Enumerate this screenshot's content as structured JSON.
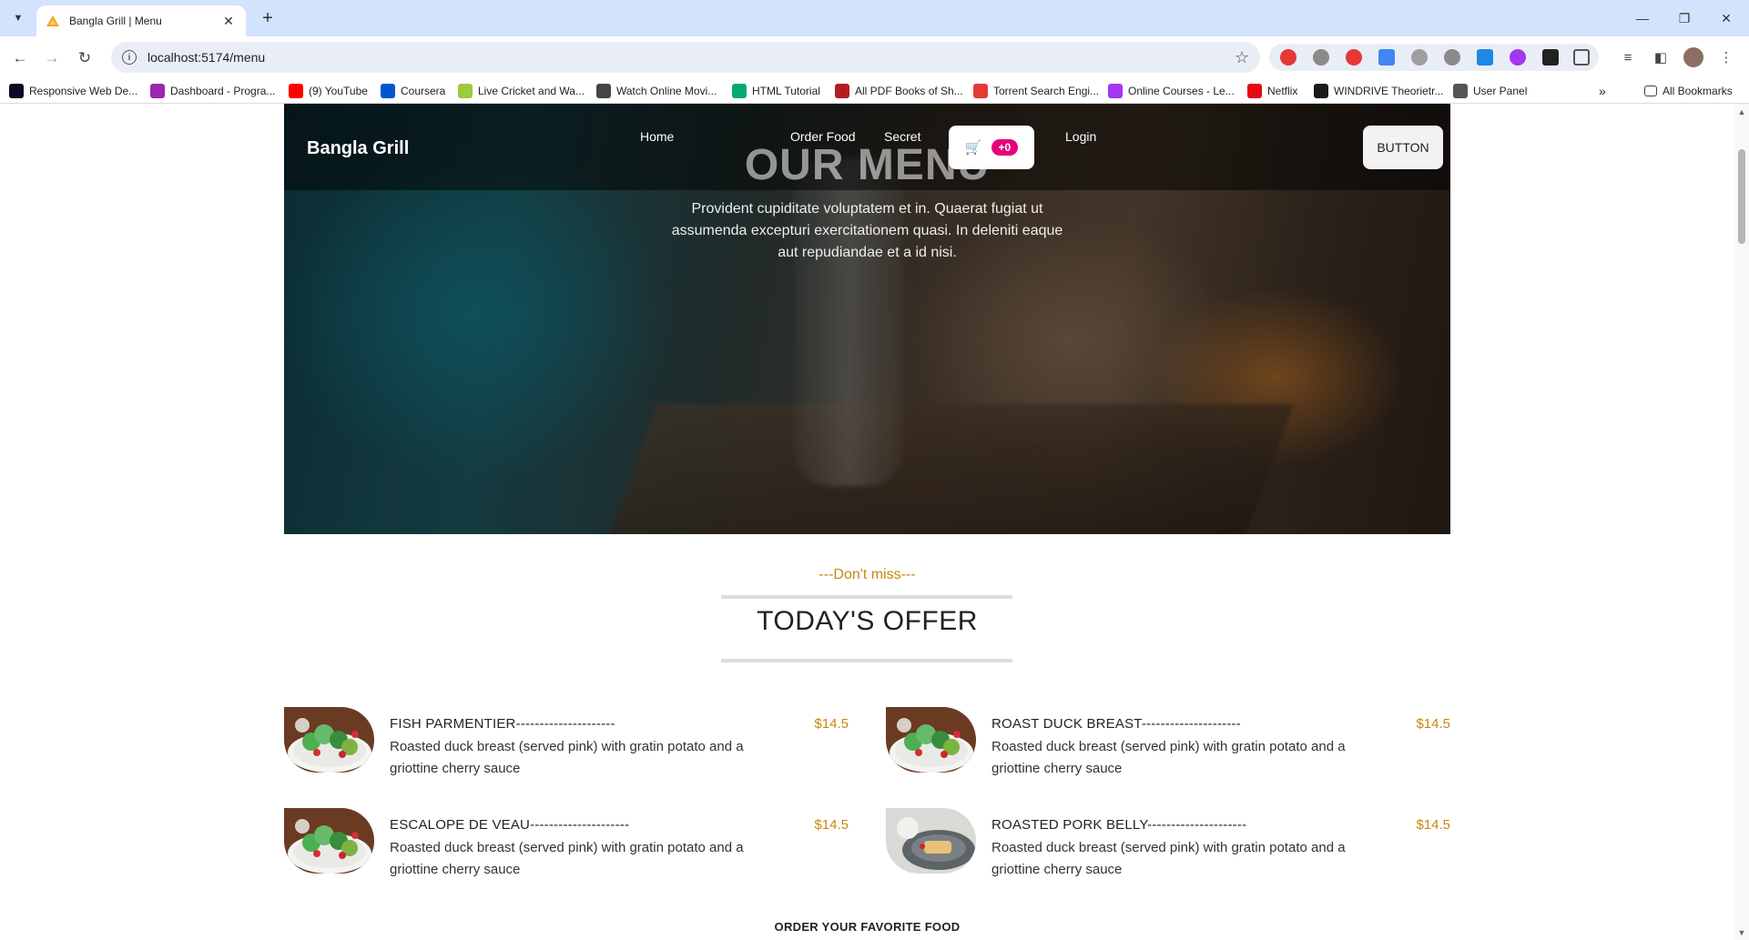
{
  "browser": {
    "tab_title": "Bangla Grill | Menu",
    "url": "localhost:5174/menu",
    "bookmarks": [
      {
        "label": "Responsive Web De...",
        "icon": "fcc-icon",
        "color": "#0a0a23"
      },
      {
        "label": "Dashboard - Progra...",
        "icon": "ph-icon",
        "color": "#9c27b0"
      },
      {
        "label": "(9) YouTube",
        "icon": "youtube-icon",
        "color": "#ff0000"
      },
      {
        "label": "Coursera",
        "icon": "coursera-icon",
        "color": "#0056d2"
      },
      {
        "label": "Live Cricket and Wa...",
        "icon": "cricket-icon",
        "color": "#9ccc3c"
      },
      {
        "label": "Watch Online Movi...",
        "icon": "reel-icon",
        "color": "#444444"
      },
      {
        "label": "HTML Tutorial",
        "icon": "w3-icon",
        "color": "#04aa6d"
      },
      {
        "label": "All PDF Books of Sh...",
        "icon": "book-icon",
        "color": "#b71c1c"
      },
      {
        "label": "Torrent Search Engi...",
        "icon": "torrent-icon",
        "color": "#e53935"
      },
      {
        "label": "Online Courses - Le...",
        "icon": "udemy-icon",
        "color": "#a435f0"
      },
      {
        "label": "Netflix",
        "icon": "netflix-icon",
        "color": "#e50914"
      },
      {
        "label": "WINDRIVE Theorietr...",
        "icon": "windrive-icon",
        "color": "#1a1a1a"
      },
      {
        "label": "User Panel",
        "icon": "globe-icon",
        "color": "#555555"
      }
    ],
    "all_bookmarks": "All Bookmarks"
  },
  "site": {
    "brand": "Bangla Grill",
    "nav": [
      "Home",
      "Order Food",
      "Secret",
      "Login"
    ],
    "cart_count": "+0",
    "button_label": "BUTTON"
  },
  "hero": {
    "title": "OUR MENU",
    "subtitle": "Provident cupiditate voluptatem et in. Quaerat fugiat ut assumenda excepturi exercitationem quasi. In deleniti eaque aut repudiandae et a id nisi."
  },
  "offer": {
    "kicker": "---Don't miss---",
    "title": "TODAY'S OFFER",
    "items": [
      {
        "name": "FISH PARMENTIER---------------------",
        "desc": "Roasted duck breast (served pink) with gratin potato and a griottine cherry sauce",
        "price": "$14.5",
        "image": "salad-plate"
      },
      {
        "name": "ROAST DUCK BREAST---------------------",
        "desc": "Roasted duck breast (served pink) with gratin potato and a griottine cherry sauce",
        "price": "$14.5",
        "image": "salad-plate"
      },
      {
        "name": "ESCALOPE DE VEAU---------------------",
        "desc": "Roasted duck breast (served pink) with gratin potato and a griottine cherry sauce",
        "price": "$14.5",
        "image": "salad-plate"
      },
      {
        "name": "ROASTED PORK BELLY---------------------",
        "desc": "Roasted duck breast (served pink) with gratin potato and a griottine cherry sauce",
        "price": "$14.5",
        "image": "pork-plate"
      }
    ]
  },
  "footer_heading": "ORDER YOUR FAVORITE FOOD",
  "colors": {
    "accent": "#c9860a",
    "badge": "#e6007e",
    "chrome": "#d3e3fd"
  }
}
